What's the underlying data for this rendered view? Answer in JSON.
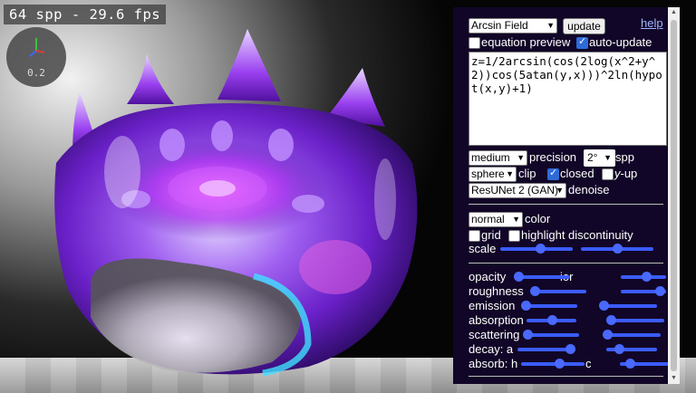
{
  "overlay": {
    "stats": "64 spp - 29.6 fps",
    "gizmo_value": "0.2"
  },
  "panel": {
    "preset": "Arcsin Field",
    "update_label": "update",
    "help_label": "help",
    "equation_preview": {
      "label": "equation preview",
      "checked": false
    },
    "auto_update": {
      "label": "auto-update",
      "checked": true
    },
    "equation": "z=1/2arcsin(cos(2log(x^2+y^2))cos(5atan(y,x)))^2ln(hypot(x,y)+1)",
    "precision": {
      "value": "medium",
      "label": "precision"
    },
    "spp": {
      "value": "2°",
      "label": "spp"
    },
    "clip": {
      "value": "sphere",
      "label": "clip"
    },
    "closed": {
      "label": "closed",
      "checked": true
    },
    "y_up": {
      "label_prefix": "y",
      "label_suffix": "-up",
      "checked": false
    },
    "denoise": {
      "value": "ResUNet 2 (GAN)",
      "label": "denoise"
    },
    "color": {
      "value": "normal",
      "label": "color"
    },
    "grid": {
      "label": "grid",
      "checked": false
    },
    "highlight": {
      "label": "highlight discontinuity",
      "checked": false
    },
    "scale": {
      "label": "scale",
      "value_a": 0.55,
      "value_b": 0.5
    },
    "sliders": [
      {
        "label": "opacity",
        "value": 0.05,
        "label2": "ior",
        "value2": 0.55
      },
      {
        "label": "roughness",
        "value": 0.05,
        "label2": "",
        "value2": 0.85
      },
      {
        "label": "emission",
        "value": 0.05,
        "label2": "",
        "value2": 0.05
      },
      {
        "label": "absorption",
        "value": 0.5,
        "label2": "",
        "value2": 0.05
      },
      {
        "label": "scattering",
        "value": 0.05,
        "label2": "",
        "value2": 0.05
      },
      {
        "label": "decay: a",
        "value": 0.9,
        "label2": "s",
        "value2": 0.25
      },
      {
        "label": "absorb: h",
        "value": 0.6,
        "label2": "c",
        "value2": 0.2
      }
    ]
  },
  "colors": {
    "panel_bg": "#110627",
    "slider_accent": "#3b5cff",
    "object_purple": "#8a2be2",
    "object_cyan": "#40e0ff"
  }
}
